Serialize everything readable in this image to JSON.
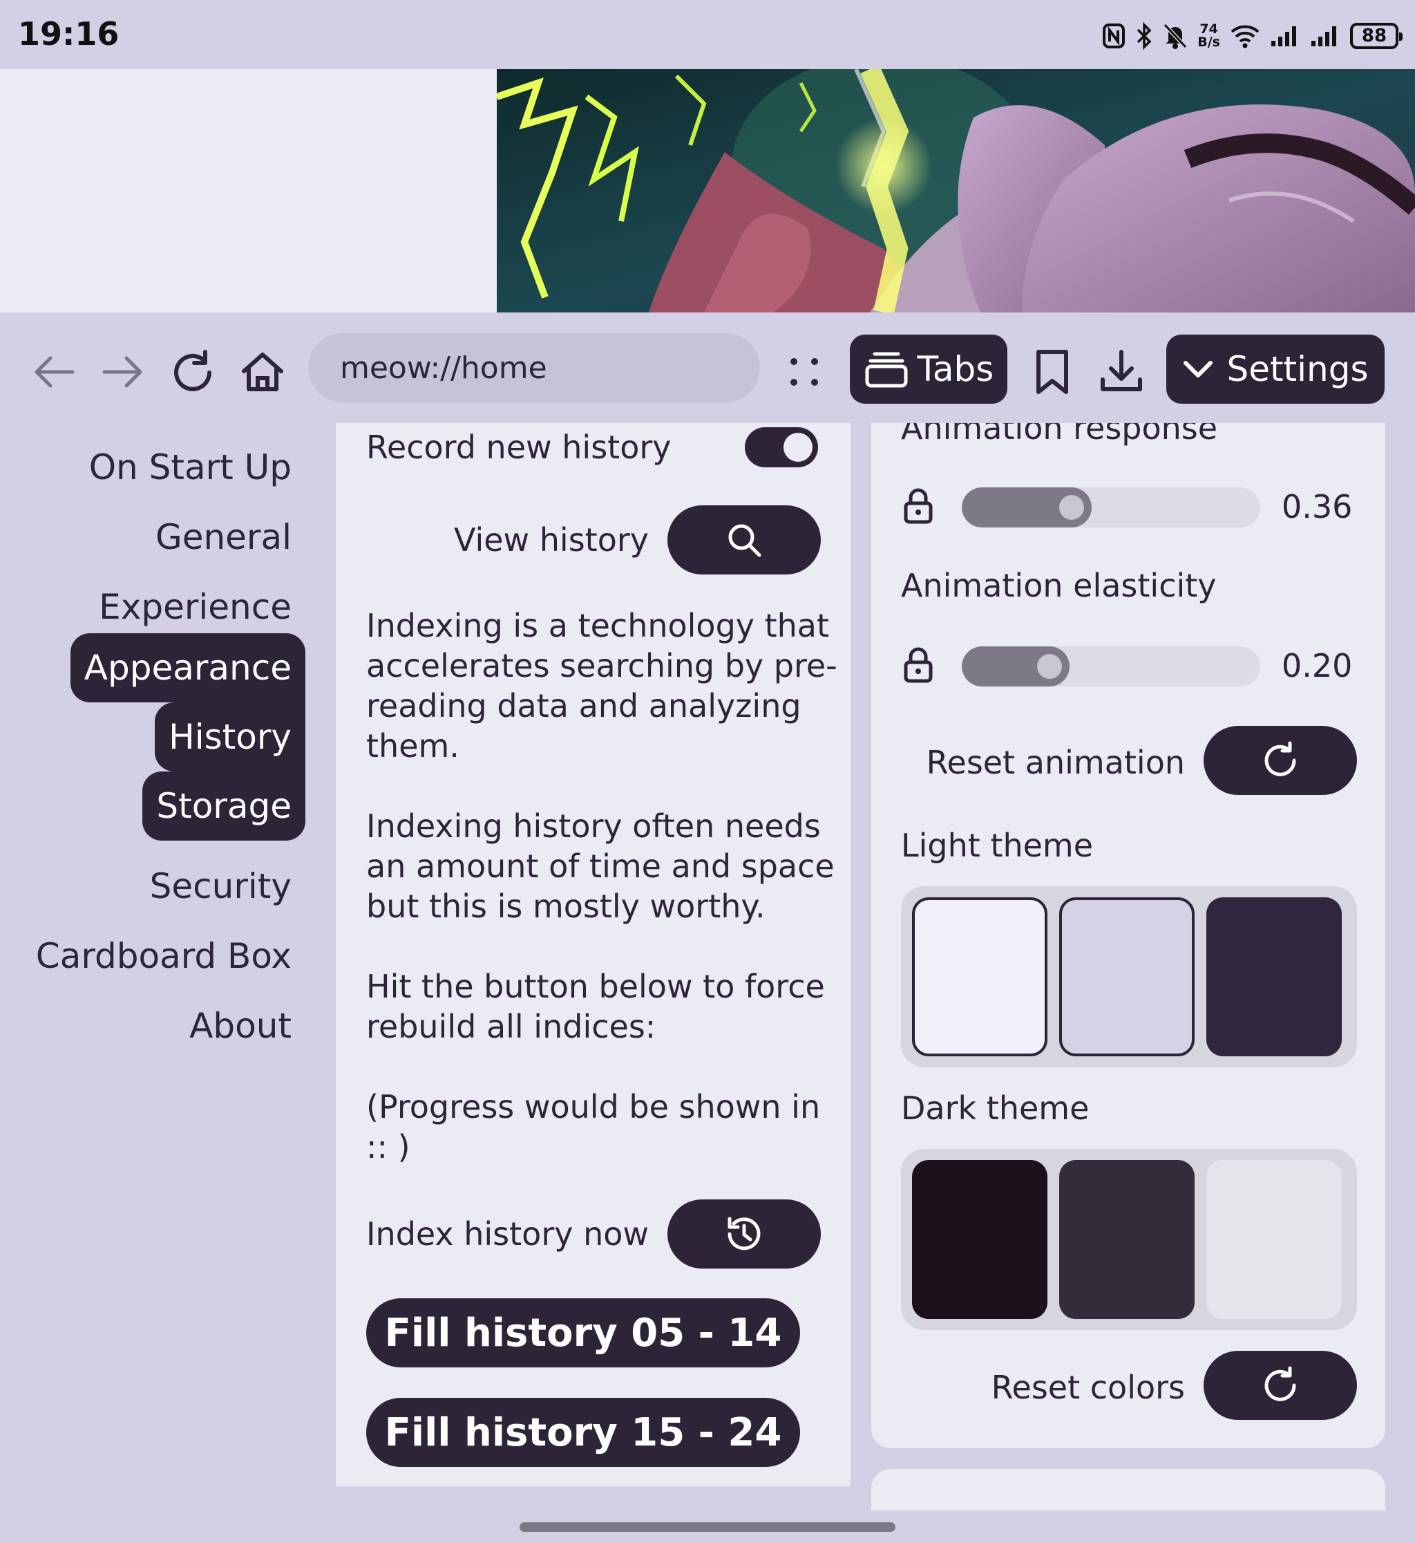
{
  "status_bar": {
    "time": "19:16",
    "net_speed_value": "74",
    "net_speed_unit": "B/s",
    "battery": "88",
    "icons": [
      "nfc-icon",
      "bluetooth-icon",
      "mute-icon",
      "wifi-icon",
      "signal-icon",
      "signal-icon"
    ]
  },
  "toolbar": {
    "url": "meow://home",
    "tabs_label": "Tabs",
    "settings_label": "Settings"
  },
  "sidebar": {
    "items": [
      {
        "label": "On Start Up",
        "active": false
      },
      {
        "label": "General",
        "active": false
      },
      {
        "label": "Experience",
        "active": false
      },
      {
        "label": "Appearance",
        "active": true
      },
      {
        "label": "History",
        "active": true
      },
      {
        "label": "Storage",
        "active": true
      },
      {
        "label": "Security",
        "active": false
      },
      {
        "label": "Cardboard Box",
        "active": false
      },
      {
        "label": "About",
        "active": false
      }
    ]
  },
  "history_panel": {
    "record_label": "Record new history",
    "record_enabled": true,
    "view_label": "View history",
    "paragraphs": [
      [
        "Indexing is a technology that",
        "accelerates searching by pre-",
        "reading data and analyzing",
        "them."
      ],
      [
        "Indexing history often needs",
        "an amount of time and space",
        "but this is mostly worthy."
      ],
      [
        "Hit the button below to force",
        "rebuild all indices:"
      ],
      [
        "(Progress would be shown in",
        ":: )"
      ]
    ],
    "index_label": "Index history now",
    "fill_buttons": [
      "Fill history 05 - 14",
      "Fill history 15 - 24"
    ]
  },
  "appearance_panel": {
    "animation_response_label": "Animation response",
    "animation_response_value": "0.36",
    "animation_elasticity_label": "Animation elasticity",
    "animation_elasticity_value": "0.20",
    "reset_animation_label": "Reset animation",
    "light_theme_label": "Light theme",
    "light_colors": [
      "#f2f1f9",
      "#d5d2e6",
      "#30263d"
    ],
    "dark_theme_label": "Dark theme",
    "dark_colors": [
      "#1c101b",
      "#342c3a",
      "#e4e4ea"
    ],
    "reset_colors_label": "Reset colors"
  },
  "colors": {
    "accent": "#2e2438",
    "background": "#d3d0e6",
    "surface": "#ebebf4"
  }
}
